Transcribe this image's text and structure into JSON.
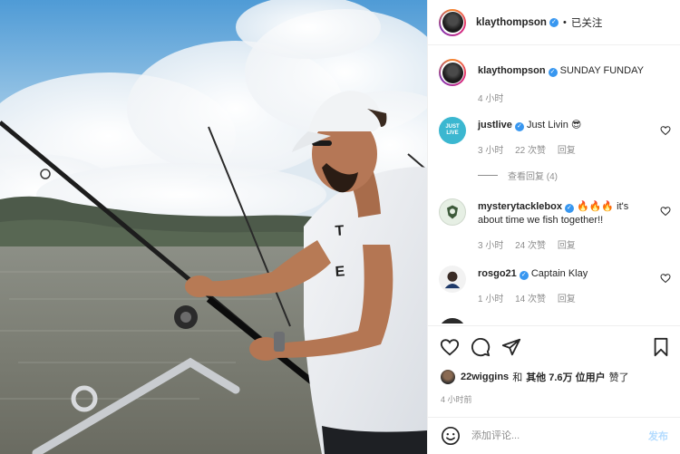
{
  "header": {
    "username": "klaythompson",
    "separator": "•",
    "follow_label": "已关注"
  },
  "caption": {
    "username": "klaythompson",
    "text": "SUNDAY FUNDAY",
    "time": "4 小时"
  },
  "comments": [
    {
      "username": "justlive",
      "text": "Just Livin 😎",
      "time": "3 小时",
      "likes": "22 次赞",
      "reply": "回复",
      "view_replies": "查看回复 (4)",
      "avatar_text": "JUST LIVE"
    },
    {
      "username": "mysterytacklebox",
      "text": "🔥🔥🔥 it's about time we fish together!!",
      "time": "3 小时",
      "likes": "24 次赞",
      "reply": "回复"
    },
    {
      "username": "rosgo21",
      "text": "Captain Klay",
      "time": "1 小时",
      "likes": "14 次赞",
      "reply": "回复"
    }
  ],
  "likes": {
    "user": "22wiggins",
    "conj": "和",
    "others": "其他 7.6万 位用户",
    "suffix": "赞了"
  },
  "post_time": "4 小时前",
  "composer": {
    "placeholder": "添加评论...",
    "post_label": "发布"
  },
  "icons": {
    "like": "heart-icon",
    "comment": "comment-icon",
    "share": "share-icon",
    "save": "bookmark-icon",
    "emoji": "emoji-icon",
    "verified": "verified-badge-icon"
  },
  "colors": {
    "verified": "#3897f0",
    "muted": "#8e8e8e",
    "text": "#262626",
    "post_disabled": "#b3dbff"
  }
}
